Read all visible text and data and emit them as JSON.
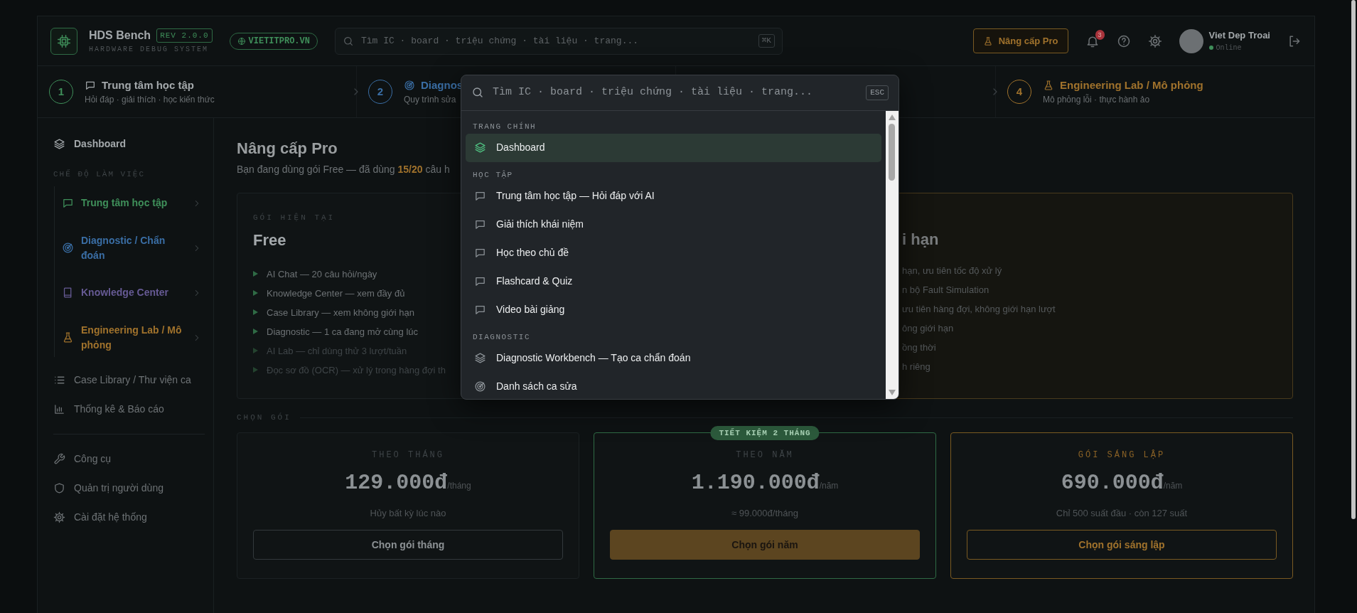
{
  "header": {
    "brand": "HDS Bench",
    "version": "REV 2.0.0",
    "tagline": "HARDWARE DEBUG SYSTEM",
    "site": "VIETITPRO.VN",
    "search": {
      "placeholder": "Tìm IC · board · triệu chứng · tài liệu · trang...",
      "shortcut": "⌘K"
    },
    "upgrade": "Nâng cấp Pro",
    "notification_count": "3",
    "user": {
      "name": "Viet Dep Troai",
      "status": "Online"
    }
  },
  "steps": [
    {
      "number": "1",
      "title": "Trung tâm học tập",
      "subtitle": "Hỏi đáp · giải thích · học kiến thức",
      "kind": "chat",
      "color": "#3f8f5a",
      "selected": true
    },
    {
      "number": "2",
      "title": "Diagnos",
      "subtitle": "Quy trình sửa",
      "kind": "target",
      "color": "#3a6ea5",
      "selected": false
    },
    {
      "number": "4",
      "title": "Engineering Lab / Mô phỏng",
      "subtitle": "Mô phỏng lỗi · thực hành ảo",
      "kind": "flask",
      "color": "#a0722c",
      "selected": false
    }
  ],
  "sidebar": {
    "top": [
      {
        "label": "Dashboard",
        "kind": "layers"
      }
    ],
    "modes_title": "CHẾ ĐỘ LÀM VIỆC",
    "modes": [
      {
        "label": "Trung tâm học tập",
        "kind": "chat",
        "color": "#3f8f5a"
      },
      {
        "label": "Diagnostic / Chẩn đoán",
        "kind": "target",
        "color": "#3a6ea5"
      },
      {
        "label": "Knowledge Center",
        "kind": "book",
        "color": "#665a94"
      },
      {
        "label": "Engineering Lab / Mô phỏng",
        "kind": "flask",
        "color": "#a0722c"
      }
    ],
    "links": [
      {
        "label": "Case Library / Thư viện ca",
        "kind": "list"
      },
      {
        "label": "Thống kê & Báo cáo",
        "kind": "chart"
      }
    ],
    "tools": [
      {
        "label": "Công cụ",
        "kind": "wrench"
      },
      {
        "label": "Quản trị người dùng",
        "kind": "shield"
      },
      {
        "label": "Cài đặt hệ thống",
        "kind": "gear"
      }
    ]
  },
  "page": {
    "title": "Nâng cấp Pro",
    "subtitle": "Bạn đang dùng gói Free — đã dùng **15/20** câu h"
  },
  "current_plan": {
    "label": "GÓI HIỆN TẠI",
    "name": "Free",
    "features": [
      {
        "text": "AI Chat — 20 câu hỏi/ngày",
        "included": true
      },
      {
        "text": "Knowledge Center — xem đầy đủ",
        "included": true
      },
      {
        "text": "Case Library — xem không giới hạn",
        "included": true
      },
      {
        "text": "Diagnostic — 1 ca đang mở cùng lúc",
        "included": true
      },
      {
        "text": "AI Lab — chỉ dùng thử 3 lượt/tuần",
        "included": false
      },
      {
        "text": "Đọc sơ đồ (OCR) — xử lý trong hàng đợi th",
        "included": false
      }
    ]
  },
  "pro_plan": {
    "name": "i hạn",
    "features": [
      "hạn, ưu tiên tốc độ xử lý",
      "n bộ Fault Simulation",
      "ưu tiên hàng đợi, không giới hạn lượt",
      "ông giới hạn",
      "ồng thời",
      "h riêng"
    ]
  },
  "plans": {
    "title": "CHỌN GÓI",
    "items": [
      {
        "kind": "plain",
        "label": "THEO THÁNG",
        "price": "129.000đ",
        "unit": "/tháng",
        "note": "Hủy bất kỳ lúc nào",
        "button": "Chọn gói tháng"
      },
      {
        "kind": "featured",
        "badge": "TIẾT KIỆM 2 THÁNG",
        "label": "THEO NĂM",
        "price": "1.190.000đ",
        "unit": "/năm",
        "note": "≈ 99.000đ/tháng",
        "button": "Chọn gói năm"
      },
      {
        "kind": "founder",
        "label": "GÓI SÁNG LẬP",
        "price": "690.000đ",
        "unit": "/năm",
        "note": "Chỉ 500 suất đầu · còn 127 suất",
        "button": "Chọn gói sáng lập"
      }
    ]
  },
  "palette": {
    "placeholder": "Tìm IC · board · triệu chứng · tài liệu · trang...",
    "shortcut": "ESC",
    "groups": [
      {
        "label": "TRANG CHÍNH",
        "items": [
          {
            "label": "Dashboard",
            "kind": "layers",
            "selected": true
          }
        ]
      },
      {
        "label": "HỌC TẬP",
        "items": [
          {
            "label": "Trung tâm học tập — Hỏi đáp với AI",
            "kind": "chat",
            "selected": false
          },
          {
            "label": "Giải thích khái niệm",
            "kind": "chat",
            "selected": false
          },
          {
            "label": "Học theo chủ đề",
            "kind": "chat",
            "selected": false
          },
          {
            "label": "Flashcard & Quiz",
            "kind": "chat",
            "selected": false
          },
          {
            "label": "Video bài giảng",
            "kind": "chat",
            "selected": false
          }
        ]
      },
      {
        "label": "DIAGNOSTIC",
        "items": [
          {
            "label": "Diagnostic Workbench — Tạo ca chẩn đoán",
            "kind": "layers",
            "selected": false
          },
          {
            "label": "Danh sách ca sửa",
            "kind": "target",
            "selected": false
          }
        ]
      }
    ]
  }
}
